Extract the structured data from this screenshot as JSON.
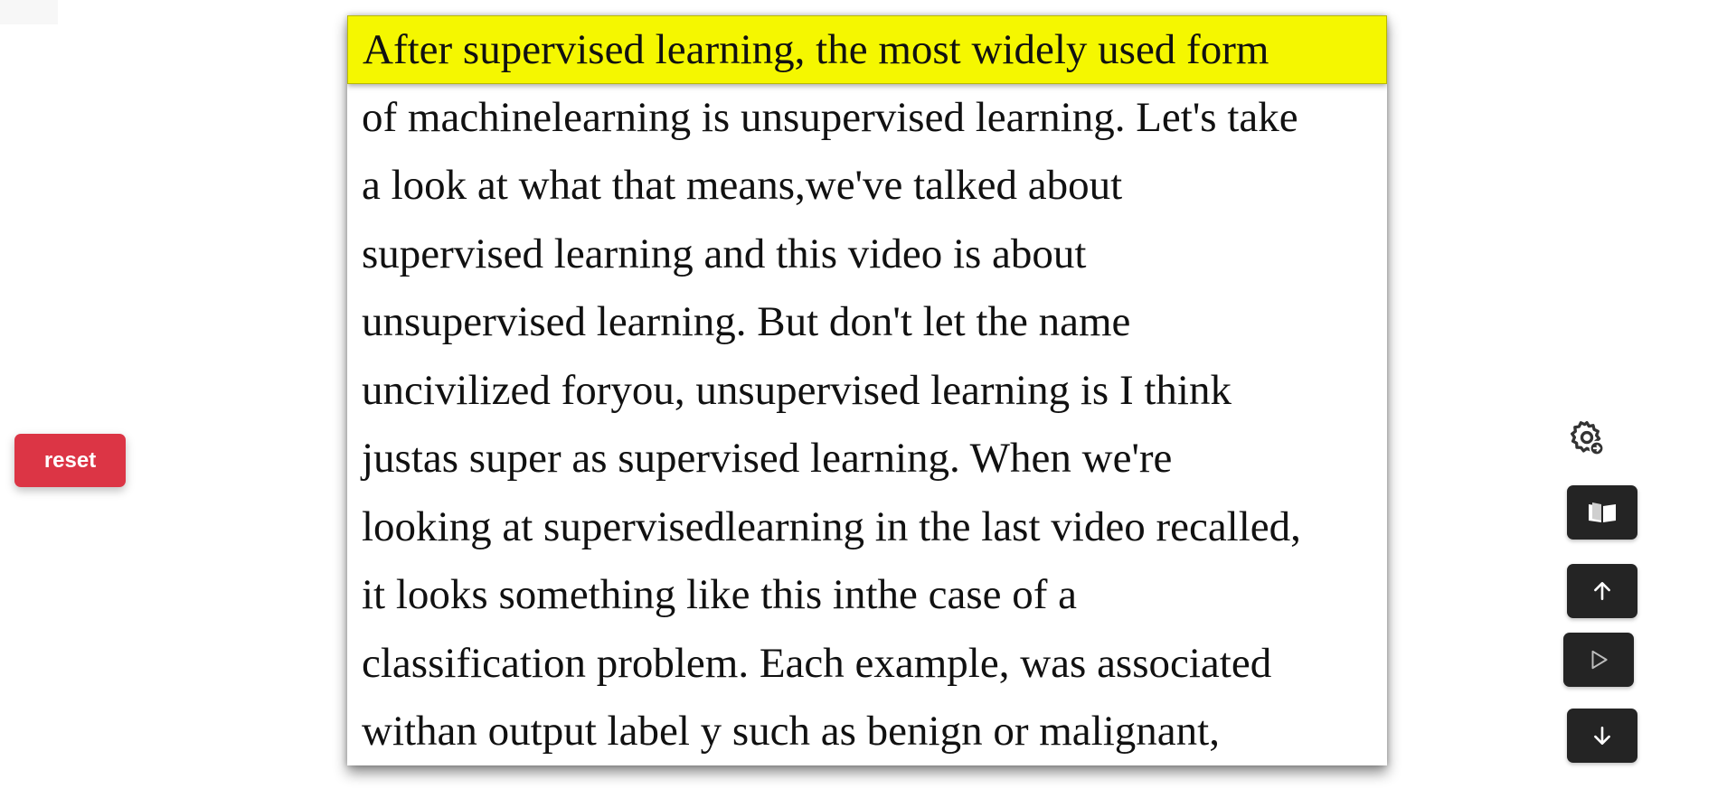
{
  "reset": {
    "label": "reset"
  },
  "reader": {
    "lines": [
      "After supervised learning, the most widely used form",
      "of machinelearning is unsupervised learning. Let's take",
      "a look at what that means,we've talked about",
      "supervised learning and this video is about",
      "unsupervised learning. But don't let the name",
      "uncivilized foryou, unsupervised learning is I think",
      "justas super as supervised learning. When we're",
      "looking at supervisedlearning in the last video recalled,",
      "it looks something like this inthe case of a",
      "classification problem. Each example, was associated",
      "withan output label y such as benign or malignant,"
    ],
    "highlighted_line_index": 0
  },
  "controls": {
    "icons": [
      "settings-gear-icon",
      "open-book-icon",
      "arrow-up-icon",
      "play-icon",
      "arrow-down-icon"
    ]
  },
  "colors": {
    "highlight": "#f5f700",
    "reset_bg": "#dc3545",
    "control_bg": "#242424"
  }
}
